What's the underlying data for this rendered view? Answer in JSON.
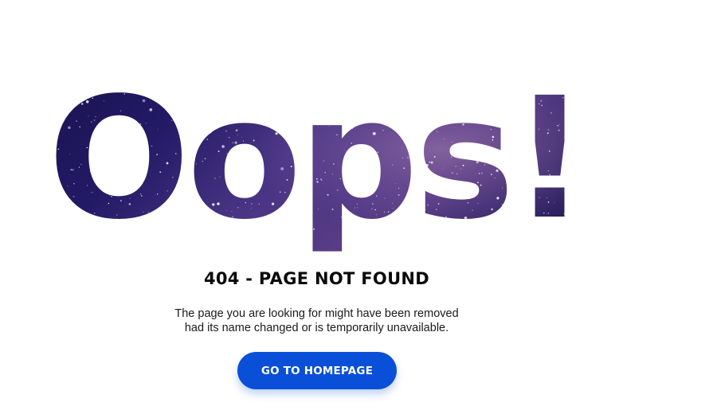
{
  "hero": {
    "text": "Oops!",
    "fill": "starry-night-sky"
  },
  "error": {
    "title": "404 - PAGE NOT FOUND",
    "description_line1": "The page you are looking for might have been removed",
    "description_line2": "had its name changed or is temporarily unavailable."
  },
  "actions": {
    "homepage_button": "GO TO HOMEPAGE"
  },
  "colors": {
    "button_bg": "#0a4fd8",
    "title_text": "#0a0a0a",
    "sky_dark": "#140f45",
    "sky_light": "#5a3f8c"
  }
}
